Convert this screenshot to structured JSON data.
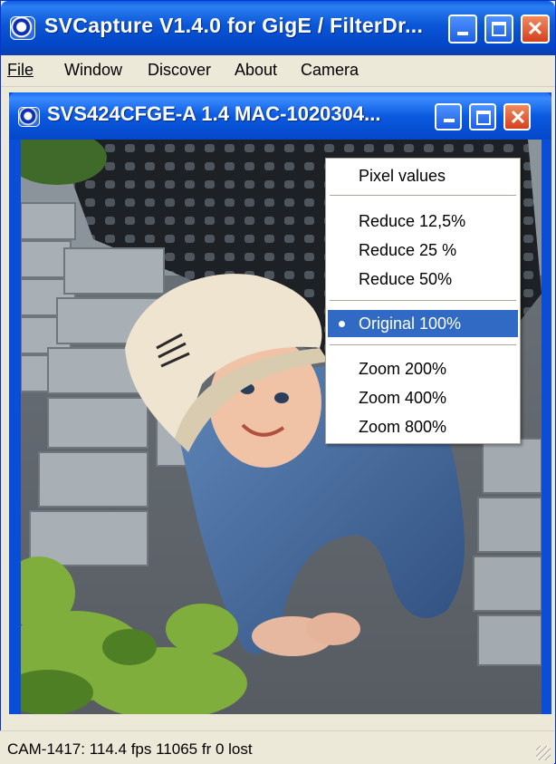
{
  "app": {
    "title": "SVCapture V1.4.0 for GigE / FilterDr..."
  },
  "menu": {
    "items": [
      "File",
      "Window",
      "Discover",
      "About",
      "Camera"
    ]
  },
  "camera_window": {
    "title": "SVS424CFGE-A 1.4 MAC-1020304..."
  },
  "context_menu": {
    "pixel_values": "Pixel values",
    "reduce_12_5": "Reduce 12,5%",
    "reduce_25": "Reduce 25 %",
    "reduce_50": "Reduce 50%",
    "original_100": "Original 100%",
    "zoom_200": "Zoom 200%",
    "zoom_400": "Zoom 400%",
    "zoom_800": "Zoom 800%",
    "selected": "Original 100%"
  },
  "status": {
    "text": "CAM-1417: 114.4 fps  11065 fr  0 lost"
  },
  "colors": {
    "titlebar_blue": "#0a56d6",
    "selection_blue": "#316ac5",
    "close_red": "#d5401e",
    "window_face": "#ece9d8"
  }
}
